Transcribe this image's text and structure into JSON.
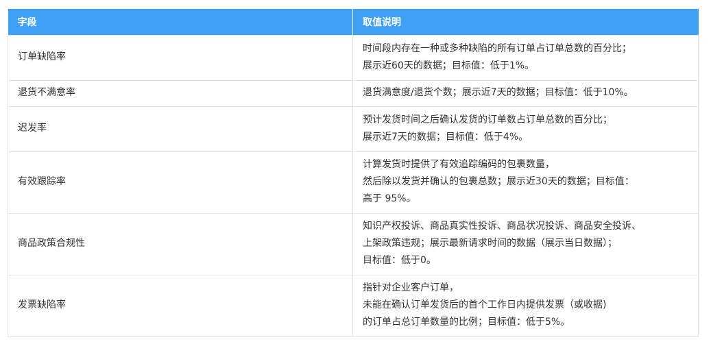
{
  "table": {
    "headers": [
      "字段",
      "取值说明"
    ],
    "rows": [
      {
        "field": "订单缺陷率",
        "desc": [
          "时间段内存在一种或多种缺陷的所有订单占订单总数的百分比；",
          "展示近60天的数据；目标值：低于1%。"
        ]
      },
      {
        "field": "退货不满意率",
        "desc": [
          "退货满意度/退货个数；展示近7天的数据；目标值：低于10%。"
        ]
      },
      {
        "field": "迟发率",
        "desc": [
          "预计发货时间之后确认发货的订单数占订单总数的百分比；",
          "展示近7天的数据；目标值：低于4%。"
        ]
      },
      {
        "field": "有效跟踪率",
        "desc": [
          "计算发货时提供了有效追踪编码的包裹数量，",
          "然后除以发货并确认的包裹总数；展示近30天的数据；目标值：",
          "高于 95%。"
        ]
      },
      {
        "field": "商品政策合规性",
        "desc": [
          "知识产权投诉、商品真实性投诉、商品状况投诉、商品安全投诉、",
          "上架政策违规；展示最新请求时间的数据（展示当日数据）；",
          "目标值：低于0。"
        ]
      },
      {
        "field": "发票缺陷率",
        "desc": [
          "指针对企业客户订单，",
          "未能在确认订单发货后的首个工作日内提供发票（或收据)",
          "的订单占总订单数量的比例；目标值：低于5%。"
        ]
      }
    ]
  },
  "colors": {
    "header_bg": "#3fa0f4",
    "header_text": "#ffffff",
    "border": "#e6e6e6",
    "body_text": "#333333"
  }
}
